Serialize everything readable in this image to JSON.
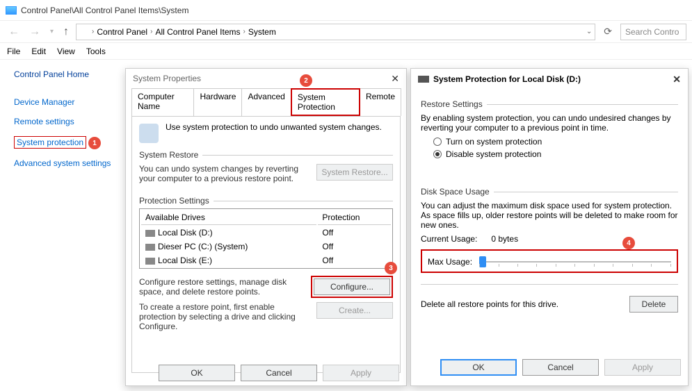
{
  "titlebar": {
    "path_text": "Control Panel\\All Control Panel Items\\System"
  },
  "path": {
    "root": "Control Panel",
    "mid": "All Control Panel Items",
    "leaf": "System"
  },
  "search": {
    "placeholder": "Search Contro"
  },
  "menubar": {
    "file": "File",
    "edit": "Edit",
    "view": "View",
    "tools": "Tools"
  },
  "sidebar": {
    "home": "Control Panel Home",
    "device_manager": "Device Manager",
    "remote_settings": "Remote settings",
    "system_protection": "System protection",
    "advanced": "Advanced system settings"
  },
  "markers": {
    "m1": "1",
    "m2": "2",
    "m3": "3",
    "m4": "4"
  },
  "dlg1": {
    "title": "System Properties",
    "tabs": {
      "computer_name": "Computer Name",
      "hardware": "Hardware",
      "advanced": "Advanced",
      "system_protection": "System Protection",
      "remote": "Remote"
    },
    "intro": "Use system protection to undo unwanted system changes.",
    "group_restore": "System Restore",
    "restore_text": "You can undo system changes by reverting your computer to a previous restore point.",
    "btn_restore": "System Restore...",
    "group_settings": "Protection Settings",
    "col_drives": "Available Drives",
    "col_protection": "Protection",
    "drives": [
      {
        "name": "Local Disk (D:)",
        "protection": "Off"
      },
      {
        "name": "Dieser PC (C:) (System)",
        "protection": "Off"
      },
      {
        "name": "Local Disk (E:)",
        "protection": "Off"
      }
    ],
    "configure_text": "Configure restore settings, manage disk space, and delete restore points.",
    "btn_configure": "Configure...",
    "create_text": "To create a restore point, first enable protection by selecting a drive and clicking Configure.",
    "btn_create": "Create...",
    "btn_ok": "OK",
    "btn_cancel": "Cancel",
    "btn_apply": "Apply"
  },
  "dlg2": {
    "title": "System Protection for Local Disk (D:)",
    "group_restore": "Restore Settings",
    "restore_text": "By enabling system protection, you can undo undesired changes by reverting your computer to a previous point in time.",
    "opt_on": "Turn on system protection",
    "opt_off": "Disable system protection",
    "group_disk": "Disk Space Usage",
    "disk_text": "You can adjust the maximum disk space used for system protection. As space fills up, older restore points will be deleted to make room for new ones.",
    "current_label": "Current Usage:",
    "current_value": "0 bytes",
    "max_label": "Max Usage:",
    "delete_text": "Delete all restore points for this drive.",
    "btn_delete": "Delete",
    "btn_ok": "OK",
    "btn_cancel": "Cancel",
    "btn_apply": "Apply"
  }
}
